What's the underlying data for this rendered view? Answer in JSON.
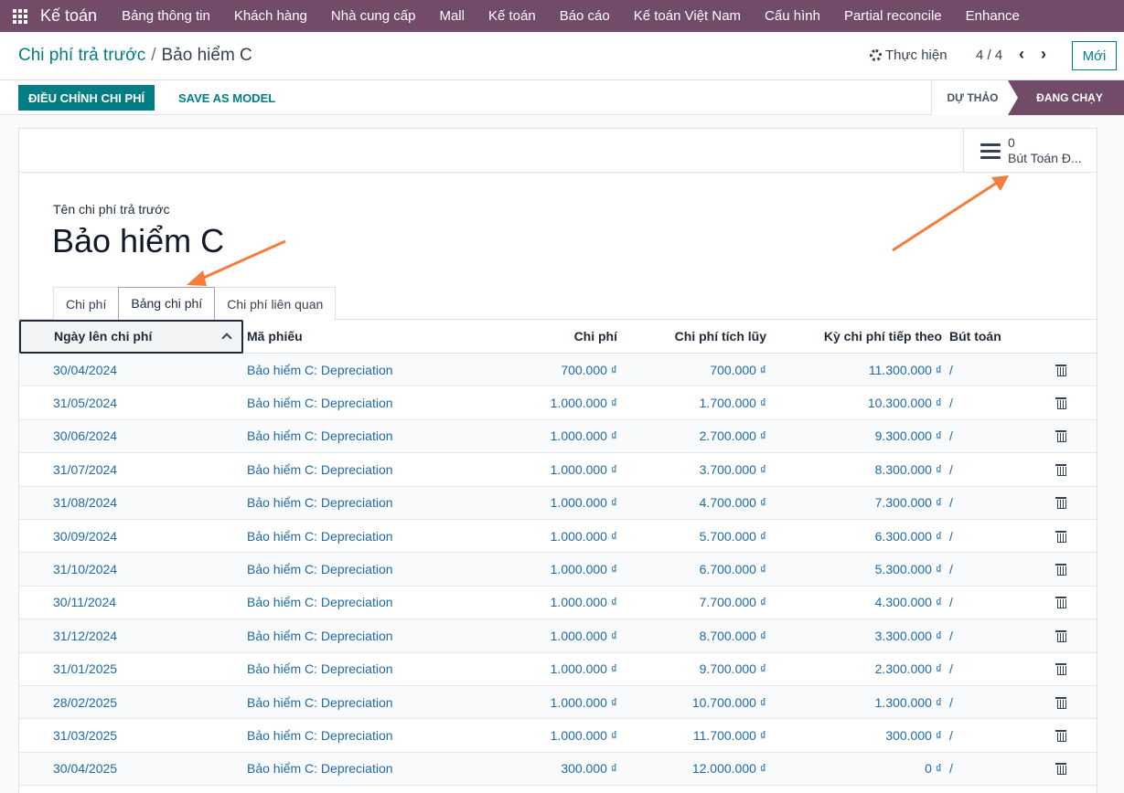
{
  "navbar": {
    "brand": "Kế toán",
    "items": [
      "Bảng thông tin",
      "Khách hàng",
      "Nhà cung cấp",
      "Mall",
      "Kế toán",
      "Báo cáo",
      "Kế toán Việt Nam",
      "Cấu hình",
      "Partial reconcile",
      "Enhance"
    ]
  },
  "breadcrumb": {
    "parent": "Chi phí trả trước",
    "separator": "/",
    "current": "Bảo hiểm C"
  },
  "actions": {
    "label": "Thực hiện"
  },
  "pager": {
    "value": "4 / 4"
  },
  "new_button": "Mới",
  "buttons": {
    "adjust": "ĐIỀU CHỈNH CHI PHÍ",
    "save_model": "SAVE AS MODEL"
  },
  "stages": {
    "draft": "DỰ THẢO",
    "running": "ĐANG CHẠY"
  },
  "smart_button": {
    "count": "0",
    "label": "Bút Toán Đ..."
  },
  "form": {
    "field_label": "Tên chi phí trả trước",
    "title": "Bảo hiểm C"
  },
  "tabs": [
    "Chi phí",
    "Bảng chi phí",
    "Chi phí liên quan"
  ],
  "table": {
    "headers": {
      "date": "Ngày lên chi phí",
      "ref": "Mã phiếu",
      "amount": "Chi phí",
      "cumulative": "Chi phí tích lũy",
      "next": "Kỳ chi phí tiếp theo",
      "move": "Bút toán"
    },
    "rows": [
      [
        "30/04/2024",
        "Bảo hiểm C: Depreciation",
        "700.000 ₫",
        "700.000 ₫",
        "11.300.000 ₫",
        "/"
      ],
      [
        "31/05/2024",
        "Bảo hiểm C: Depreciation",
        "1.000.000 ₫",
        "1.700.000 ₫",
        "10.300.000 ₫",
        "/"
      ],
      [
        "30/06/2024",
        "Bảo hiểm C: Depreciation",
        "1.000.000 ₫",
        "2.700.000 ₫",
        "9.300.000 ₫",
        "/"
      ],
      [
        "31/07/2024",
        "Bảo hiểm C: Depreciation",
        "1.000.000 ₫",
        "3.700.000 ₫",
        "8.300.000 ₫",
        "/"
      ],
      [
        "31/08/2024",
        "Bảo hiểm C: Depreciation",
        "1.000.000 ₫",
        "4.700.000 ₫",
        "7.300.000 ₫",
        "/"
      ],
      [
        "30/09/2024",
        "Bảo hiểm C: Depreciation",
        "1.000.000 ₫",
        "5.700.000 ₫",
        "6.300.000 ₫",
        "/"
      ],
      [
        "31/10/2024",
        "Bảo hiểm C: Depreciation",
        "1.000.000 ₫",
        "6.700.000 ₫",
        "5.300.000 ₫",
        "/"
      ],
      [
        "30/11/2024",
        "Bảo hiểm C: Depreciation",
        "1.000.000 ₫",
        "7.700.000 ₫",
        "4.300.000 ₫",
        "/"
      ],
      [
        "31/12/2024",
        "Bảo hiểm C: Depreciation",
        "1.000.000 ₫",
        "8.700.000 ₫",
        "3.300.000 ₫",
        "/"
      ],
      [
        "31/01/2025",
        "Bảo hiểm C: Depreciation",
        "1.000.000 ₫",
        "9.700.000 ₫",
        "2.300.000 ₫",
        "/"
      ],
      [
        "28/02/2025",
        "Bảo hiểm C: Depreciation",
        "1.000.000 ₫",
        "10.700.000 ₫",
        "1.300.000 ₫",
        "/"
      ],
      [
        "31/03/2025",
        "Bảo hiểm C: Depreciation",
        "1.000.000 ₫",
        "11.700.000 ₫",
        "300.000 ₫",
        "/"
      ],
      [
        "30/04/2025",
        "Bảo hiểm C: Depreciation",
        "300.000 ₫",
        "12.000.000 ₫",
        "0 ₫",
        "/"
      ]
    ]
  },
  "colors": {
    "navbar": "#714b67",
    "primary": "#017e84",
    "link": "#1f6aa5",
    "annotation_arrow": "#f47c3c"
  }
}
